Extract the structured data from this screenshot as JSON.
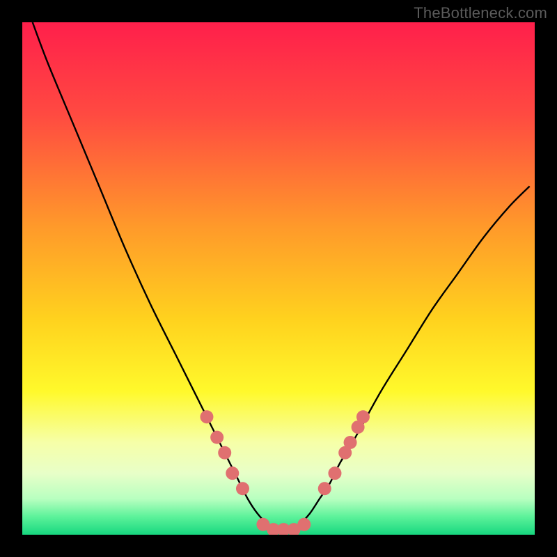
{
  "watermark": "TheBottleneck.com",
  "chart_data": {
    "type": "line",
    "title": "",
    "xlabel": "",
    "ylabel": "",
    "xlim": [
      0,
      100
    ],
    "ylim": [
      0,
      100
    ],
    "grid": false,
    "legend": false,
    "series": [
      {
        "name": "curve",
        "x": [
          2,
          5,
          10,
          15,
          20,
          25,
          30,
          33,
          36,
          38,
          40,
          42,
          44,
          46,
          48,
          50,
          52,
          54,
          56,
          58,
          60,
          62,
          65,
          70,
          75,
          80,
          85,
          90,
          95,
          99
        ],
        "y": [
          100,
          92,
          80,
          68,
          56,
          45,
          35,
          29,
          23,
          19,
          15,
          11,
          7,
          4,
          2,
          1,
          1,
          2,
          4,
          7,
          10,
          14,
          19,
          28,
          36,
          44,
          51,
          58,
          64,
          68
        ]
      }
    ],
    "markers": {
      "name": "highlighted-points",
      "color": "#e07070",
      "points": [
        {
          "x": 36,
          "y": 23
        },
        {
          "x": 38,
          "y": 19
        },
        {
          "x": 39.5,
          "y": 16
        },
        {
          "x": 41,
          "y": 12
        },
        {
          "x": 43,
          "y": 9
        },
        {
          "x": 47,
          "y": 2
        },
        {
          "x": 49,
          "y": 1
        },
        {
          "x": 51,
          "y": 1
        },
        {
          "x": 53,
          "y": 1
        },
        {
          "x": 55,
          "y": 2
        },
        {
          "x": 59,
          "y": 9
        },
        {
          "x": 61,
          "y": 12
        },
        {
          "x": 63,
          "y": 16
        },
        {
          "x": 64,
          "y": 18
        },
        {
          "x": 65.5,
          "y": 21
        },
        {
          "x": 66.5,
          "y": 23
        }
      ]
    },
    "background_gradient": {
      "stops": [
        {
          "offset": 0.0,
          "color": "#ff1f4b"
        },
        {
          "offset": 0.18,
          "color": "#ff4a41"
        },
        {
          "offset": 0.4,
          "color": "#ff9a2a"
        },
        {
          "offset": 0.58,
          "color": "#ffd21e"
        },
        {
          "offset": 0.72,
          "color": "#fff92b"
        },
        {
          "offset": 0.82,
          "color": "#f6ffa8"
        },
        {
          "offset": 0.88,
          "color": "#e8ffc8"
        },
        {
          "offset": 0.93,
          "color": "#b8ffc0"
        },
        {
          "offset": 0.965,
          "color": "#5cf29a"
        },
        {
          "offset": 1.0,
          "color": "#17d77f"
        }
      ]
    }
  }
}
